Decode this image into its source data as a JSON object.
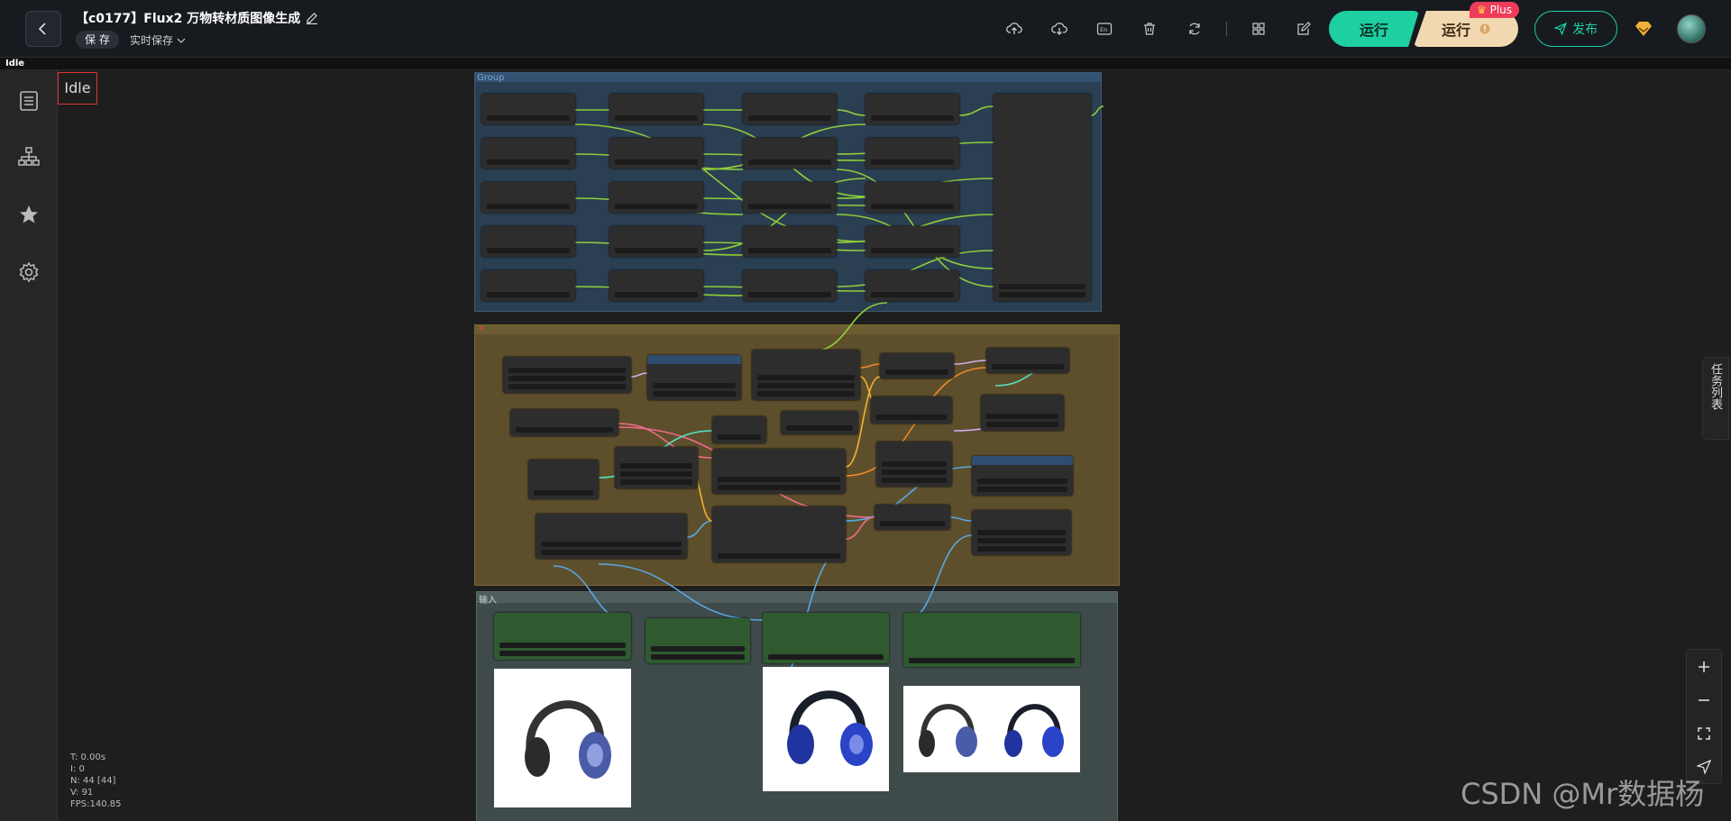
{
  "header": {
    "title": "【c0177】Flux2 万物转材质图像生成",
    "save_label": "保 存",
    "autosave_label": "实时保存",
    "run_label": "运行",
    "run_plus_label": "运行",
    "plus_badge": "Plus",
    "publish_label": "发布"
  },
  "status_strip": "Idle",
  "canvas": {
    "idle_label": "Idle",
    "group_titles": {
      "group1": "Group",
      "group2": "",
      "group3": "输入"
    }
  },
  "stats": {
    "t": "T: 0.00s",
    "i": "I: 0",
    "n": "N: 44 [44]",
    "v": "V: 91",
    "fps": "FPS:140.85"
  },
  "task_list_label": "任务列表",
  "watermark": "CSDN @Mr数据杨",
  "colors": {
    "accent": "#1ecfa1",
    "plus": "#f2d8b0",
    "badge": "#ef3c5a",
    "group1": "#2c4a66",
    "group2": "#6b5a2e",
    "group3": "#4a5a5a",
    "node_green": "#2f5a2f"
  }
}
